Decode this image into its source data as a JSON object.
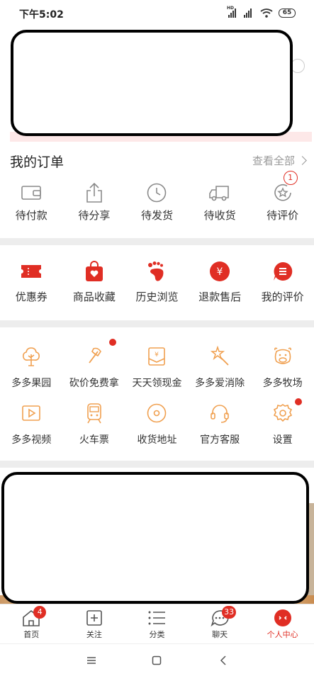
{
  "status_bar": {
    "time": "下午5:02",
    "hd": "HD",
    "battery": "65"
  },
  "orders": {
    "title": "我的订单",
    "view_all": "查看全部",
    "items": [
      {
        "label": "待付款",
        "icon": "wallet-icon"
      },
      {
        "label": "待分享",
        "icon": "share-icon"
      },
      {
        "label": "待发货",
        "icon": "clock-icon"
      },
      {
        "label": "待收货",
        "icon": "truck-icon"
      },
      {
        "label": "待评价",
        "icon": "review-icon",
        "badge": "1"
      }
    ]
  },
  "services": {
    "items": [
      {
        "label": "优惠券",
        "icon": "coupon-icon"
      },
      {
        "label": "商品收藏",
        "icon": "favorite-bag-icon"
      },
      {
        "label": "历史浏览",
        "icon": "footprint-icon"
      },
      {
        "label": "退款售后",
        "icon": "refund-icon"
      },
      {
        "label": "我的评价",
        "icon": "my-review-icon"
      }
    ]
  },
  "tools": {
    "row1": [
      {
        "label": "多多果园",
        "icon": "tree-icon"
      },
      {
        "label": "砍价免费拿",
        "icon": "axe-icon",
        "dot": true
      },
      {
        "label": "天天领现金",
        "icon": "cash-envelope-icon"
      },
      {
        "label": "多多爱消除",
        "icon": "star-wand-icon"
      },
      {
        "label": "多多牧场",
        "icon": "cow-icon"
      }
    ],
    "row2": [
      {
        "label": "多多视频",
        "icon": "video-icon"
      },
      {
        "label": "火车票",
        "icon": "train-icon"
      },
      {
        "label": "收货地址",
        "icon": "location-icon"
      },
      {
        "label": "官方客服",
        "icon": "headset-icon"
      },
      {
        "label": "设置",
        "icon": "gear-icon",
        "dot": true
      }
    ]
  },
  "tabbar": {
    "tabs": [
      {
        "label": "首页",
        "icon": "home-icon",
        "badge": "4"
      },
      {
        "label": "关注",
        "icon": "follow-icon"
      },
      {
        "label": "分类",
        "icon": "category-icon"
      },
      {
        "label": "聊天",
        "icon": "chat-icon",
        "badge": "33"
      },
      {
        "label": "个人中心",
        "icon": "profile-icon",
        "active": true
      }
    ]
  },
  "colors": {
    "accent": "#e02e24",
    "icon_orange": "#f0a050",
    "icon_grey": "#8a8a8a"
  }
}
